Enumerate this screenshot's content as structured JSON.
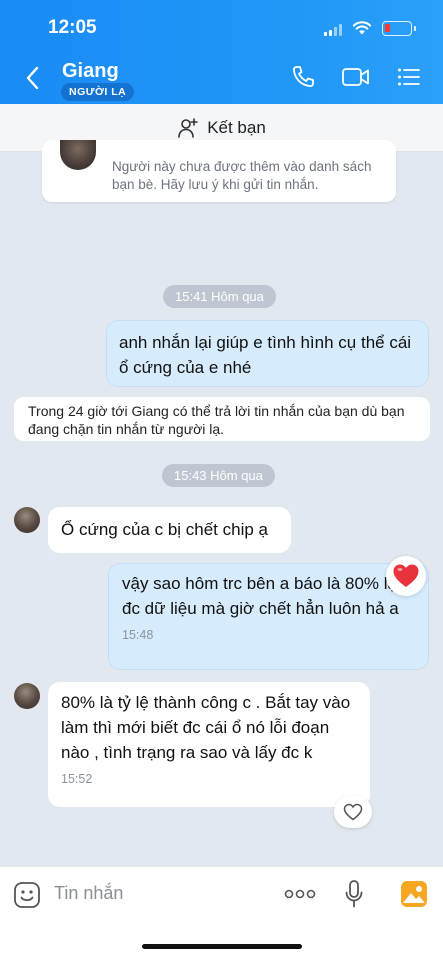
{
  "status_bar": {
    "time": "12:05"
  },
  "header": {
    "contact_name": "Giang",
    "badge": "NGƯỜI LẠ",
    "icons": [
      "back-icon",
      "phone-icon",
      "video-call-icon",
      "menu-icon"
    ]
  },
  "add_friend": {
    "label": "Kết bạn"
  },
  "notice": {
    "text": "Người này chưa được thêm vào danh sách bạn bè. Hãy lưu ý khi gửi tin nhắn."
  },
  "messages": [
    {
      "type": "timestamp",
      "text": "15:41 Hôm qua"
    },
    {
      "type": "outgoing",
      "text": "anh nhắn lại giúp e tình hình cụ thể cái ổ cứng của e nhé"
    },
    {
      "type": "system",
      "text": "Trong 24 giờ tới Giang có thể trả lời tin nhắn của bạn dù bạn đang chặn tin nhắn từ người lạ."
    },
    {
      "type": "timestamp",
      "text": "15:43 Hôm qua"
    },
    {
      "type": "incoming",
      "text": "Ổ cứng của c  bị chết chip ạ"
    },
    {
      "type": "outgoing",
      "text": "vậy sao hôm trc bên a báo là 80% lại đc dữ liệu mà giờ chết hẳn luôn hả a",
      "time": "15:48",
      "reaction": "heart"
    },
    {
      "type": "incoming",
      "text": "80% là tỷ lệ thành công c .  Bắt tay vào làm thì mới biết đc cái ổ nó lỗi đoạn nào , tình trạng ra sao và lấy đc k",
      "time": "15:52"
    }
  ],
  "composer": {
    "placeholder": "Tin nhắn"
  },
  "colors": {
    "header_blue": "#1f96f7",
    "outgoing_bubble": "#d6ecfd",
    "chat_bg": "#e2e8f0",
    "heart": "#e8323c"
  }
}
